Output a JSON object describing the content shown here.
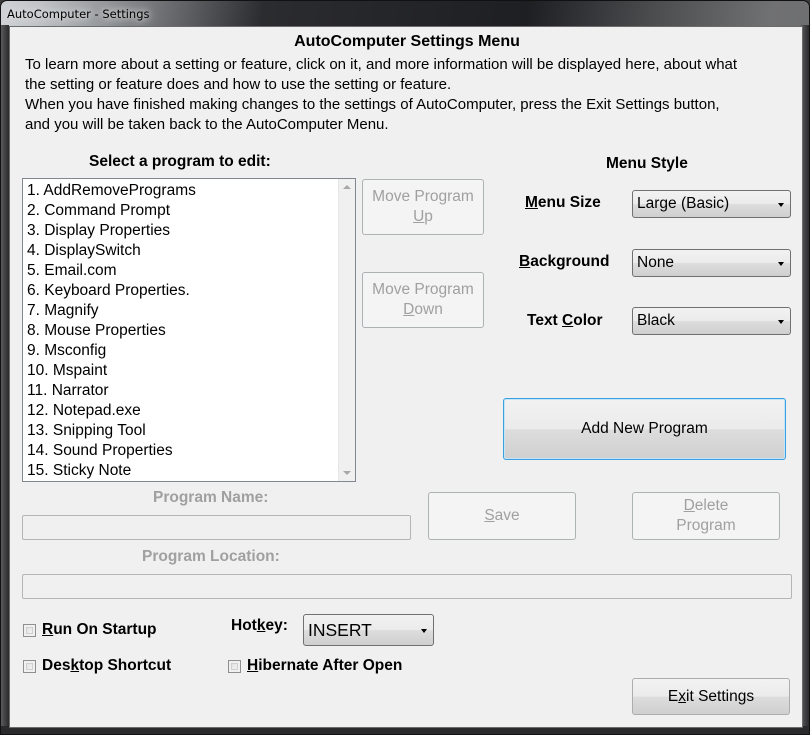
{
  "window": {
    "title": "AutoComputer - Settings"
  },
  "header": {
    "heading": "AutoComputer Settings Menu",
    "intro_line1": "To learn more about a setting or feature, click on it, and more information will be displayed here, about what",
    "intro_line2": "the setting or feature does and how to use the setting or feature.",
    "intro_line3": "When you have finished making changes to the settings of AutoComputer, press the Exit Settings button,",
    "intro_line4": "and you will be taken back to the AutoComputer Menu."
  },
  "program_list": {
    "label": "Select a program to edit:",
    "items": [
      "1. AddRemovePrograms",
      "2. Command Prompt",
      "3. Display Properties",
      "4. DisplaySwitch",
      "5. Email.com",
      "6. Keyboard Properties.",
      "7. Magnify",
      "8. Mouse Properties",
      "9. Msconfig",
      "10. Mspaint",
      "11. Narrator",
      "12. Notepad.exe",
      "13. Snipping Tool",
      "14. Sound Properties",
      "15. Sticky Note"
    ]
  },
  "move_buttons": {
    "up_line1": "Move Program",
    "up_line2_accel": "U",
    "up_line2_rest": "p",
    "down_line1": "Move Program",
    "down_line2_accel": "D",
    "down_line2_rest": "own"
  },
  "menu_style": {
    "title": "Menu Style",
    "menu_size_label_accel": "M",
    "menu_size_label_rest": "enu Size",
    "menu_size_value": "Large (Basic)",
    "background_label_accel": "B",
    "background_label_rest": "ackground",
    "background_value": "None",
    "text_color_label_pre": "Text ",
    "text_color_label_accel": "C",
    "text_color_label_rest": "olor",
    "text_color_value": "Black"
  },
  "add_program_button": "Add New Program",
  "program_name": {
    "label": "Program Name:",
    "value": ""
  },
  "program_location": {
    "label": "Program Location:",
    "value": ""
  },
  "save_button": {
    "accel": "S",
    "rest": "ave"
  },
  "delete_button": {
    "line1_accel": "D",
    "line1_rest": "elete",
    "line2": "Program"
  },
  "options": {
    "run_on_startup_accel": "R",
    "run_on_startup_rest": "un On Startup",
    "run_on_startup_checked": false,
    "desktop_shortcut_pre": "Des",
    "desktop_shortcut_accel": "k",
    "desktop_shortcut_rest": "top Shortcut",
    "desktop_shortcut_checked": false,
    "hibernate_accel": "H",
    "hibernate_rest": "ibernate After Open",
    "hibernate_checked": false,
    "hotkey_label_pre": "Hot",
    "hotkey_label_accel": "k",
    "hotkey_label_rest": "ey:",
    "hotkey_value": "INSERT"
  },
  "exit_button": {
    "pre": "E",
    "accel": "x",
    "rest": "it Settings"
  }
}
